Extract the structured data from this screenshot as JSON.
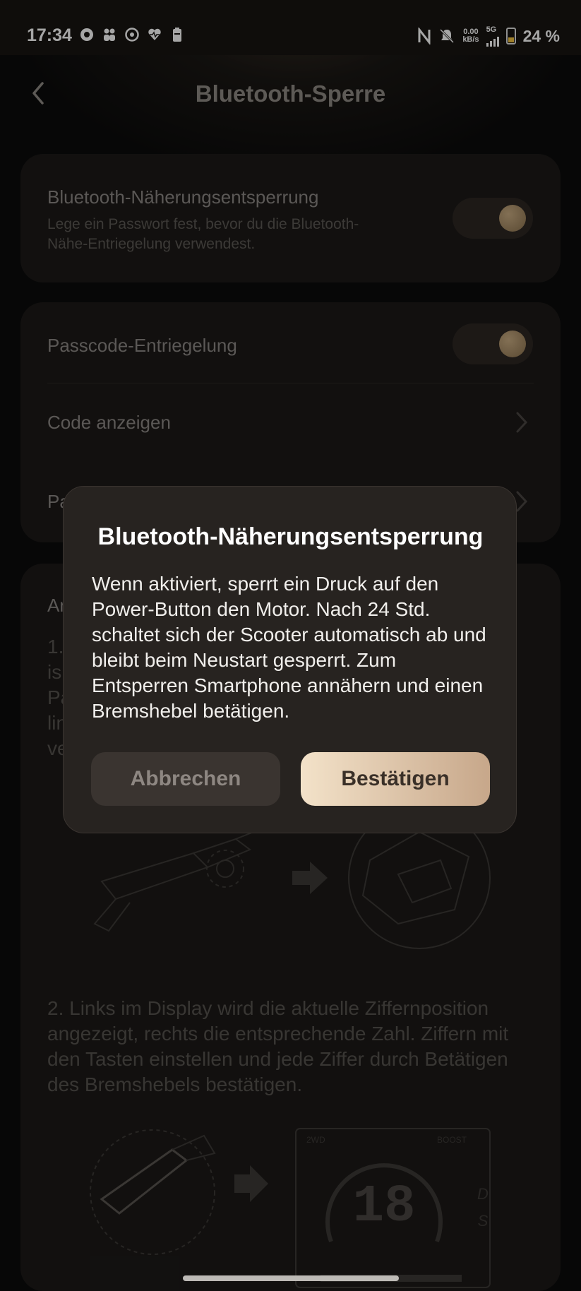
{
  "status_bar": {
    "time": "17:34",
    "speed_value": "0.00",
    "speed_unit": "kB/s",
    "network": "5G",
    "battery": "24 %",
    "icons": [
      "chat-bubble-icon",
      "users-icon",
      "lion-app-icon",
      "heartbeat-icon",
      "battery-small-icon",
      "nfc-icon",
      "bell-muted-icon",
      "signal-icon"
    ]
  },
  "header": {
    "title": "Bluetooth-Sperre"
  },
  "settings": {
    "proximity": {
      "title": "Bluetooth-Näherungsentsperrung",
      "subtitle": "Lege ein Passwort fest, bevor du die Bluetooth-Nähe-Entriegelung verwendest.",
      "enabled": true
    },
    "passcode": {
      "title": "Passcode-Entriegelung",
      "enabled": true
    },
    "show_code": "Code anzeigen",
    "third_row_visible": "Pa"
  },
  "instructions": {
    "heading_visible": "An",
    "step1_visible": [
      "1.",
      "is",
      "Pa",
      "lin",
      "ve"
    ],
    "step2": "2. Links im Display wird die aktuelle Ziffernposition angezeigt, rechts die entsprechende Zahl. Ziffern mit den Tasten einstellen und jede Ziffer durch Betätigen des Bremshebels bestätigen.",
    "display_digits": "18",
    "display_boost": "BOOST",
    "display_2wd": "2WD",
    "display_d": "D",
    "display_s": "S"
  },
  "dialog": {
    "title": "Bluetooth-Näherungsentsperrung",
    "body": "Wenn aktiviert, sperrt ein Druck auf den Power-Button den Motor. Nach 24 Std. schaltet sich der Scooter automatisch ab und bleibt beim Neustart gesperrt. Zum Entsperren Smartphone annähern und einen Bremshebel betätigen.",
    "cancel_label": "Abbrechen",
    "confirm_label": "Bestätigen"
  },
  "colors": {
    "accent": "#c9ac82",
    "confirm_button": "#f3e2c9",
    "card_bg": "#1c1a18"
  }
}
